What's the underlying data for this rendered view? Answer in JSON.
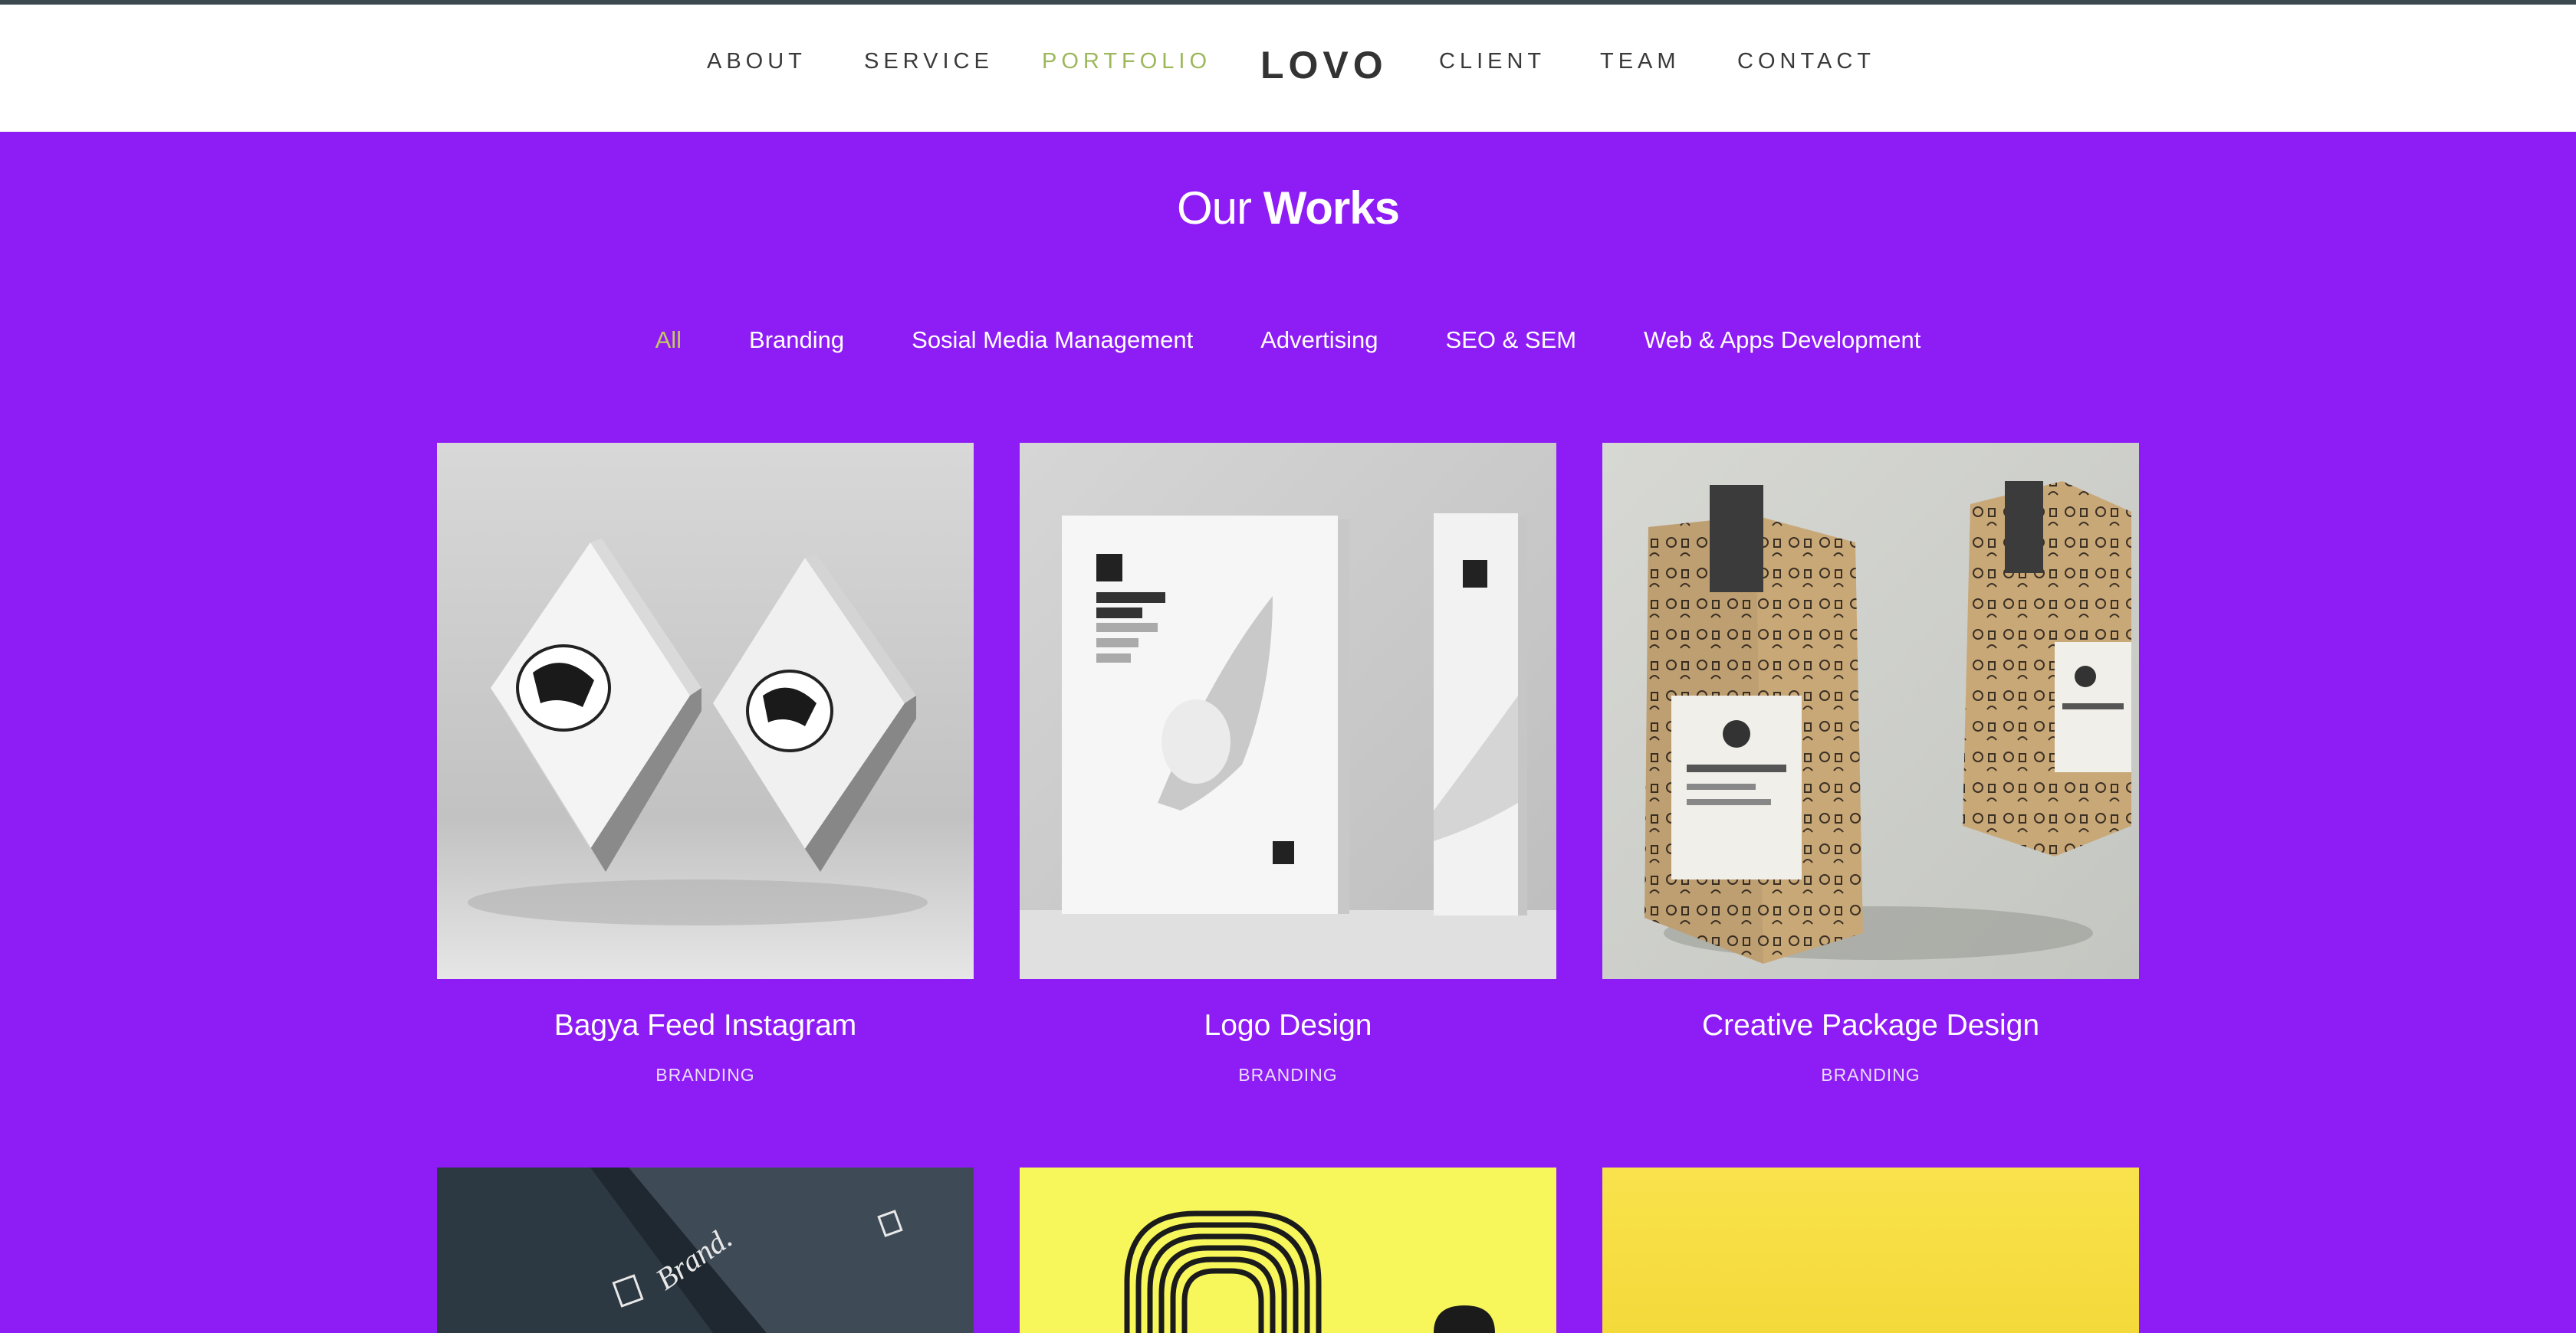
{
  "nav": {
    "left": [
      "ABOUT",
      "SERVICE",
      "PORTFOLIO"
    ],
    "logo": "LOVO",
    "right": [
      "CLIENT",
      "TEAM",
      "CONTACT"
    ],
    "active": "PORTFOLIO"
  },
  "section": {
    "title_light": "Our",
    "title_bold": "Works"
  },
  "filters": [
    "All",
    "Branding",
    "Sosial Media Management",
    "Advertising",
    "SEO & SEM",
    "Web & Apps Development"
  ],
  "works": [
    {
      "title": "Bagya Feed Instagram",
      "category": "BRANDING",
      "image": "square-box-packaging-photo"
    },
    {
      "title": "Logo Design",
      "category": "BRANDING",
      "image": "product-box-mockup-photo"
    },
    {
      "title": "Creative Package Design",
      "category": "BRANDING",
      "image": "kraft-coffee-bag-photo"
    }
  ],
  "works_partial": [
    {
      "image": "dark-brand-box-photo",
      "image_text": "Brand."
    },
    {
      "image": "yellow-line-art-photo"
    },
    {
      "image": "yellow-solid-photo"
    }
  ],
  "colors": {
    "accent_purple": "#8e1cf5",
    "active_nav": "#9cb85a",
    "active_filter": "#c4c860",
    "topbar": "#3c4a4f"
  }
}
